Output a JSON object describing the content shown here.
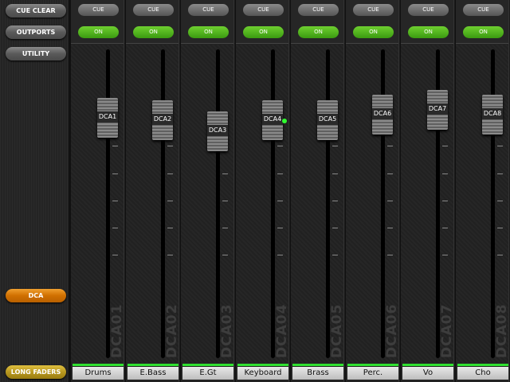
{
  "sidebar": {
    "cue_clear": "CUE CLEAR",
    "outports": "OUTPORTS",
    "utility": "UTILITY",
    "dca": "DCA",
    "long_faders": "LONG FADERS"
  },
  "colors": {
    "on": "#4ab01a",
    "dca_active": "#e08010",
    "long_faders": "#c0a020",
    "meter": "#30e030"
  },
  "channels": [
    {
      "cue": "CUE",
      "on": "ON",
      "fader_label": "DCA1",
      "vertical_label": "DCA01",
      "name": "Drums",
      "level": 0.82,
      "indicator": false
    },
    {
      "cue": "CUE",
      "on": "ON",
      "fader_label": "DCA2",
      "vertical_label": "DCA02",
      "name": "E.Bass",
      "level": 0.81,
      "indicator": false
    },
    {
      "cue": "CUE",
      "on": "ON",
      "fader_label": "DCA3",
      "vertical_label": "DCA03",
      "name": "E.Gt",
      "level": 0.77,
      "indicator": false
    },
    {
      "cue": "CUE",
      "on": "ON",
      "fader_label": "DCA4",
      "vertical_label": "DCA04",
      "name": "Keyboard",
      "level": 0.81,
      "indicator": true
    },
    {
      "cue": "CUE",
      "on": "ON",
      "fader_label": "DCA5",
      "vertical_label": "DCA05",
      "name": "Brass",
      "level": 0.81,
      "indicator": false
    },
    {
      "cue": "CUE",
      "on": "ON",
      "fader_label": "DCA6",
      "vertical_label": "DCA06",
      "name": "Perc.",
      "level": 0.83,
      "indicator": false
    },
    {
      "cue": "CUE",
      "on": "ON",
      "fader_label": "DCA7",
      "vertical_label": "DCA07",
      "name": "Vo",
      "level": 0.85,
      "indicator": false
    },
    {
      "cue": "CUE",
      "on": "ON",
      "fader_label": "DCA8",
      "vertical_label": "DCA08",
      "name": "Cho",
      "level": 0.83,
      "indicator": false
    }
  ]
}
